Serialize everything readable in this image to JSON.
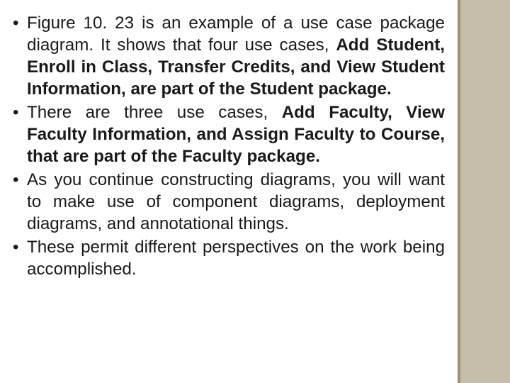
{
  "bullets": [
    {
      "pre": "Figure 10. 23 is an example of a use case package diagram. It shows that four use cases, ",
      "bold": "Add Student, Enroll in Class, Transfer Credits, and View Student Information, are part of the Student package.",
      "post": ""
    },
    {
      "pre": "There are three use cases, ",
      "bold": "Add Faculty, View Faculty Information, and Assign Faculty to Course, that are part of the Faculty package.",
      "post": ""
    },
    {
      "pre": "As you continue constructing diagrams, you will want to make use of component diagrams, deployment diagrams, and annotational things.",
      "bold": "",
      "post": ""
    },
    {
      "pre": "These permit different perspectives on the work being accomplished.",
      "bold": "",
      "post": ""
    }
  ]
}
